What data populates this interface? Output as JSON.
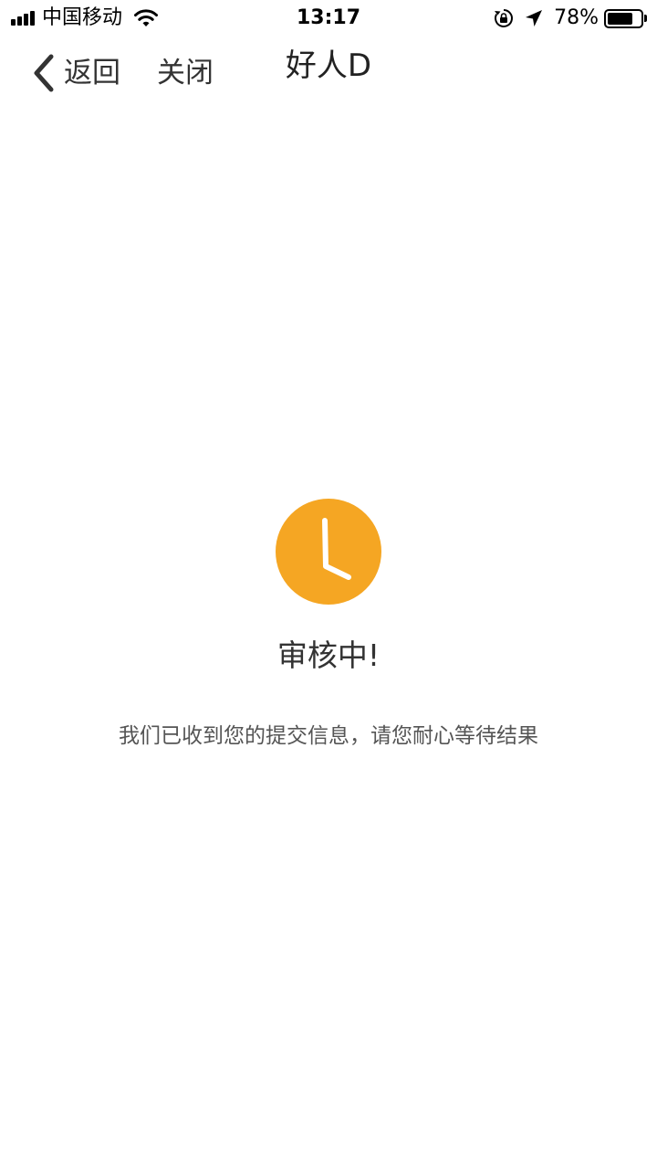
{
  "status_bar": {
    "carrier": "中国移动",
    "time": "13:17",
    "battery_percent": "78%",
    "battery_level": 0.78,
    "icons": [
      "signal-icon",
      "wifi-icon",
      "rotation-lock-icon",
      "location-arrow-icon",
      "battery-icon"
    ]
  },
  "nav": {
    "back_label": "返回",
    "close_label": "关闭",
    "title": "好人D",
    "back_icon": "chevron-left-icon"
  },
  "review": {
    "icon": "clock-icon",
    "accent_color": "#F5A623",
    "heading": "审核中!",
    "message": "我们已收到您的提交信息，请您耐心等待结果"
  }
}
